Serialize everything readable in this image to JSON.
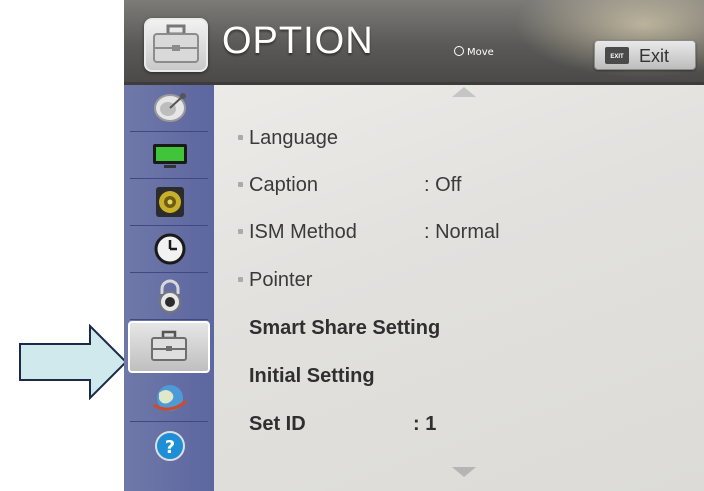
{
  "header": {
    "title": "OPTION",
    "move_hint": "Move",
    "exit_key": "EXIT",
    "exit_label": "Exit"
  },
  "sidebar": {
    "items": [
      {
        "name": "satellite-icon"
      },
      {
        "name": "tv-picture-icon"
      },
      {
        "name": "speaker-icon"
      },
      {
        "name": "clock-icon"
      },
      {
        "name": "lock-icon"
      },
      {
        "name": "toolbox-icon",
        "active": true
      },
      {
        "name": "network-globe-icon"
      },
      {
        "name": "help-icon"
      }
    ]
  },
  "menu": {
    "items": [
      {
        "label": "Language",
        "value": ""
      },
      {
        "label": "Caption",
        "value": ": Off"
      },
      {
        "label": "ISM Method",
        "value": ": Normal"
      },
      {
        "label": "Pointer",
        "value": ""
      },
      {
        "label": "Smart Share Setting",
        "value": ""
      },
      {
        "label": "Initial Setting",
        "value": ""
      },
      {
        "label": "Set ID",
        "value": ": 1"
      }
    ]
  },
  "colors": {
    "sidebar": "#5c66a0",
    "panel": "#e4e3e0",
    "header": "#5a5957",
    "arrow_fill": "#cfe9ec",
    "arrow_stroke": "#1b2a4a"
  },
  "pointer_arrow": {
    "name": "arrow-pointer-icon"
  }
}
